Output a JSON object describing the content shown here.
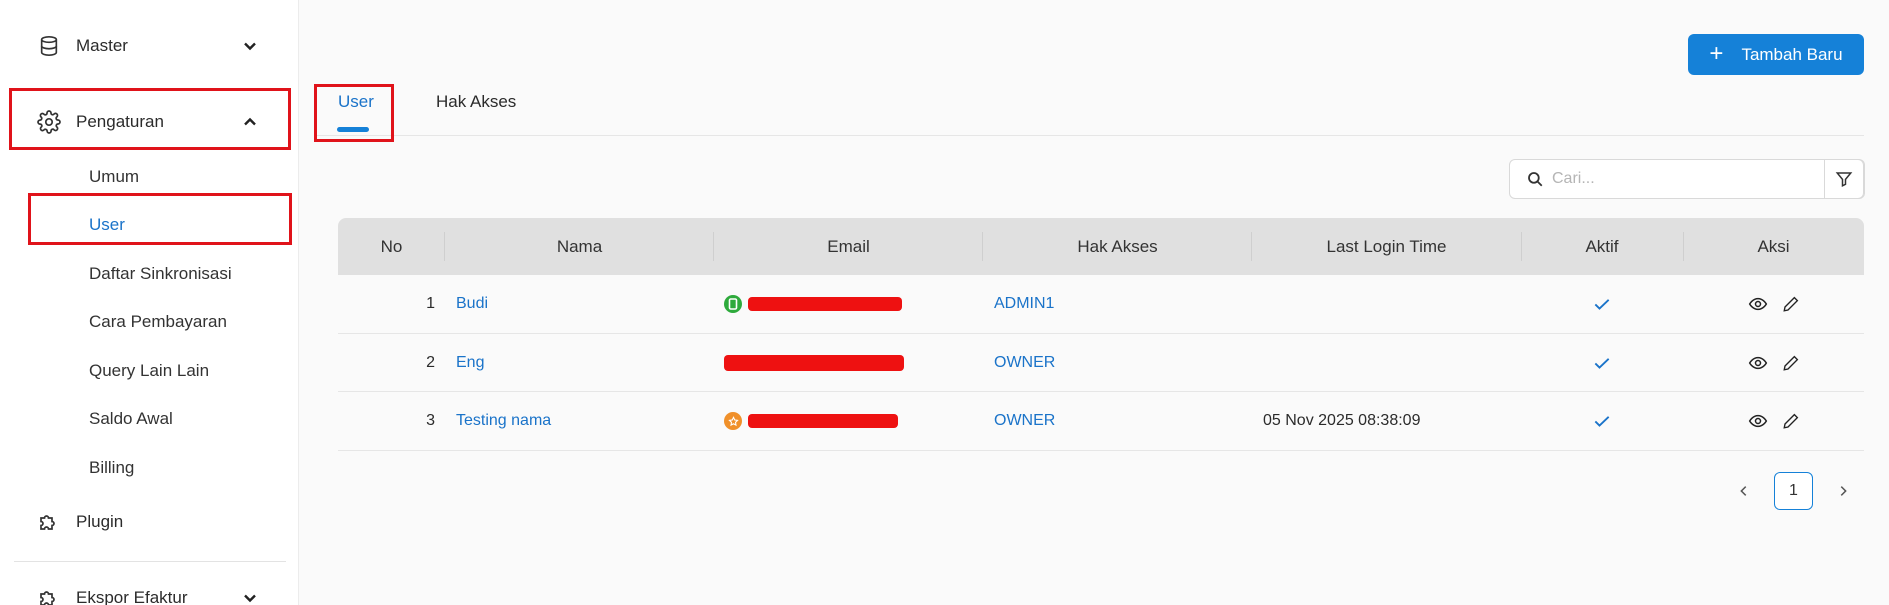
{
  "sidebar": {
    "master": "Master",
    "pengaturan": "Pengaturan",
    "sub": [
      "Umum",
      "User",
      "Daftar Sinkronisasi",
      "Cara Pembayaran",
      "Query Lain Lain",
      "Saldo Awal",
      "Billing"
    ],
    "plugin": "Plugin",
    "ekspor": "Ekspor Efaktur"
  },
  "header": {
    "add_button": "Tambah Baru"
  },
  "tabs": [
    {
      "label": "User",
      "active": true
    },
    {
      "label": "Hak Akses",
      "active": false
    }
  ],
  "search": {
    "placeholder": "Cari..."
  },
  "table": {
    "headers": [
      "No",
      "Nama",
      "Email",
      "Hak Akses",
      "Last Login Time",
      "Aktif",
      "Aksi"
    ],
    "rows": [
      {
        "no": "1",
        "nama": "Budi",
        "hak": "ADMIN1",
        "last_login": "",
        "aktif": true,
        "badge": "phone",
        "badge_color": "#2eaa3c"
      },
      {
        "no": "2",
        "nama": "Eng",
        "hak": "OWNER",
        "last_login": "",
        "aktif": true,
        "badge": "none",
        "badge_color": ""
      },
      {
        "no": "3",
        "nama": "Testing nama",
        "hak": "OWNER",
        "last_login": "05 Nov 2025 08:38:09",
        "aktif": true,
        "badge": "star",
        "badge_color": "#f0902a"
      }
    ]
  },
  "pagination": {
    "current": "1"
  },
  "colors": {
    "primary": "#1581d8",
    "link": "#1a73c9",
    "highlight": "#e0131a",
    "redaction": "#ee1111"
  }
}
